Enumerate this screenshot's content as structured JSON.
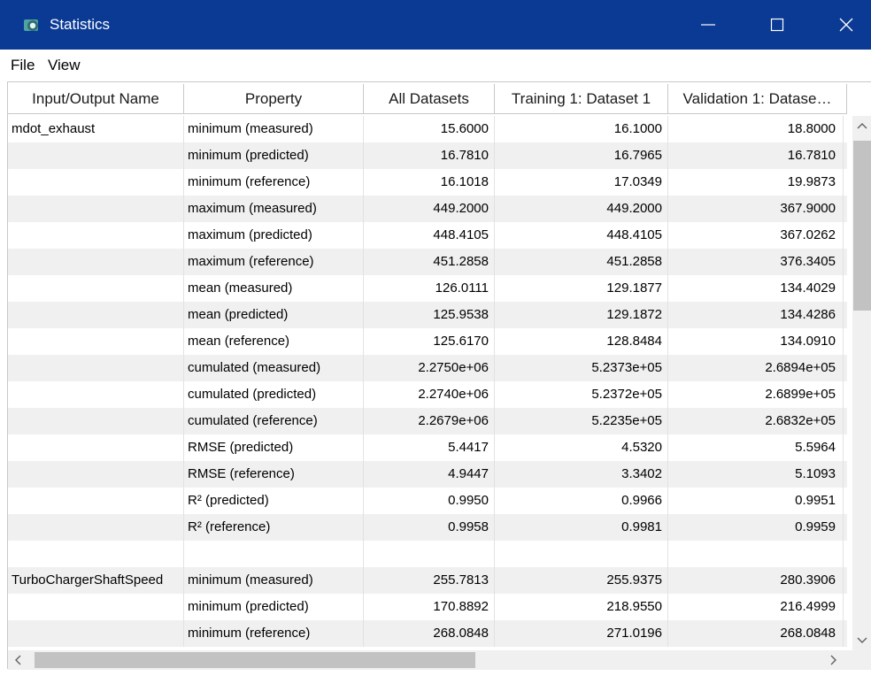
{
  "window": {
    "title": "Statistics",
    "title_bar_color": "#0b3a94"
  },
  "menu": {
    "file": "File",
    "view": "View"
  },
  "table": {
    "columns": [
      "Input/Output Name",
      "Property",
      "All Datasets",
      "Training 1: Dataset 1",
      "Validation 1: Datase…"
    ],
    "rows": [
      [
        "mdot_exhaust",
        "minimum (measured)",
        "15.6000",
        "16.1000",
        "18.8000"
      ],
      [
        "",
        "minimum (predicted)",
        "16.7810",
        "16.7965",
        "16.7810"
      ],
      [
        "",
        "minimum (reference)",
        "16.1018",
        "17.0349",
        "19.9873"
      ],
      [
        "",
        "maximum (measured)",
        "449.2000",
        "449.2000",
        "367.9000"
      ],
      [
        "",
        "maximum (predicted)",
        "448.4105",
        "448.4105",
        "367.0262"
      ],
      [
        "",
        "maximum (reference)",
        "451.2858",
        "451.2858",
        "376.3405"
      ],
      [
        "",
        "mean (measured)",
        "126.0111",
        "129.1877",
        "134.4029"
      ],
      [
        "",
        "mean (predicted)",
        "125.9538",
        "129.1872",
        "134.4286"
      ],
      [
        "",
        "mean (reference)",
        "125.6170",
        "128.8484",
        "134.0910"
      ],
      [
        "",
        "cumulated (measured)",
        "2.2750e+06",
        "5.2373e+05",
        "2.6894e+05"
      ],
      [
        "",
        "cumulated (predicted)",
        "2.2740e+06",
        "5.2372e+05",
        "2.6899e+05"
      ],
      [
        "",
        "cumulated (reference)",
        "2.2679e+06",
        "5.2235e+05",
        "2.6832e+05"
      ],
      [
        "",
        "RMSE (predicted)",
        "5.4417",
        "4.5320",
        "5.5964"
      ],
      [
        "",
        "RMSE (reference)",
        "4.9447",
        "3.3402",
        "5.1093"
      ],
      [
        "",
        "R² (predicted)",
        "0.9950",
        "0.9966",
        "0.9951"
      ],
      [
        "",
        "R² (reference)",
        "0.9958",
        "0.9981",
        "0.9959"
      ],
      [
        "",
        "",
        "",
        "",
        ""
      ],
      [
        "TurboChargerShaftSpeed",
        "minimum (measured)",
        "255.7813",
        "255.9375",
        "280.3906"
      ],
      [
        "",
        "minimum (predicted)",
        "170.8892",
        "218.9550",
        "216.4999"
      ],
      [
        "",
        "minimum (reference)",
        "268.0848",
        "271.0196",
        "268.0848"
      ]
    ]
  }
}
